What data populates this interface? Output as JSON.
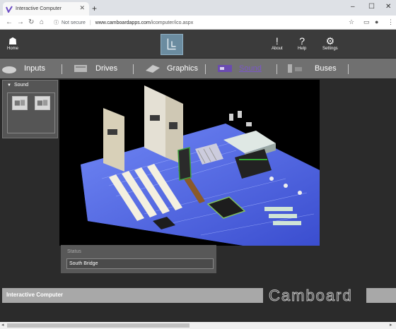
{
  "browser": {
    "tab_title": "Interactive Computer",
    "new_tab": "+",
    "not_secure": "Not secure",
    "url_host": "www.camboardapps.com",
    "url_path": "/icomputer/ico.aspx"
  },
  "toolbar": {
    "home_label": "Home",
    "about_label": "About",
    "help_label": "Help",
    "settings_label": "Settings"
  },
  "menu": {
    "items": [
      {
        "label": "Inputs"
      },
      {
        "label": "Drives"
      },
      {
        "label": "Graphics"
      },
      {
        "label": "Sound"
      },
      {
        "label": "Buses"
      }
    ],
    "active": "Sound"
  },
  "sidebar": {
    "title": "Sound"
  },
  "status": {
    "label": "Status",
    "value": "South Bridge"
  },
  "footer": {
    "title": "Interactive Computer",
    "brand": "Camboard"
  },
  "colors": {
    "app_bg": "#2b2b2b",
    "menubar": "#707070",
    "active_menu": "#7a57c8",
    "board": "#4a6cf0"
  }
}
